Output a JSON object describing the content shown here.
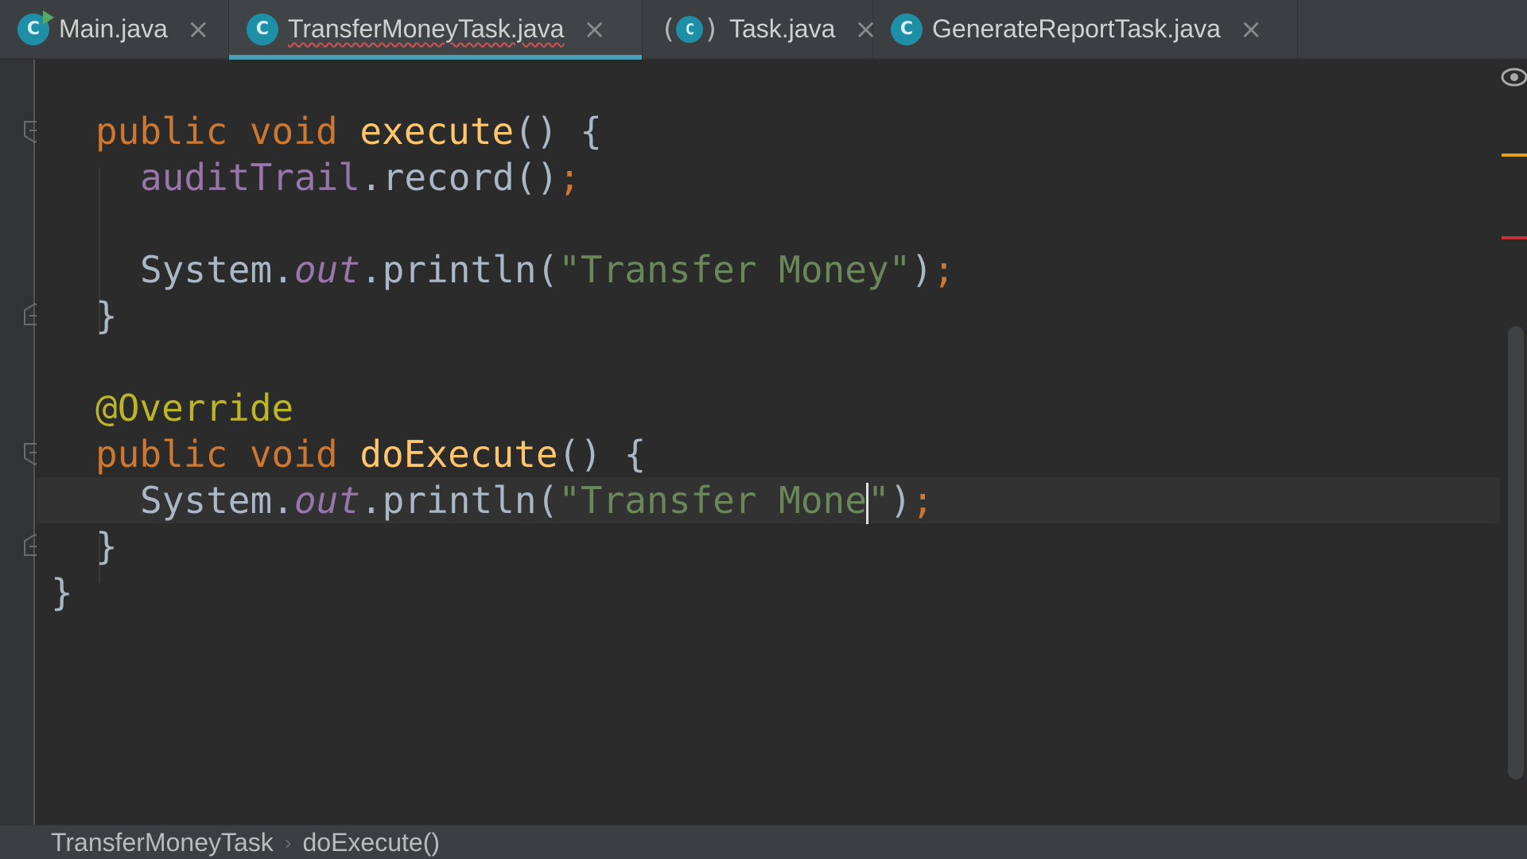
{
  "tabs": [
    {
      "label": "Main.java",
      "icon": "java-class-runnable-icon",
      "active": false
    },
    {
      "label": "TransferMoneyTask.java",
      "icon": "java-class-icon",
      "active": true,
      "error": true
    },
    {
      "label": "Task.java",
      "icon": "java-abstract-class-icon",
      "active": false
    },
    {
      "label": "GenerateReportTask.java",
      "icon": "java-class-icon",
      "active": false
    }
  ],
  "tab_icon_letter": "C",
  "close_glyph": "×",
  "code": {
    "l1_kw": "public void ",
    "l1_fn": "execute",
    "l1_rest": "() {",
    "l2_field": "auditTrail",
    "l2_rest": ".record()",
    "l2_semi": ";",
    "l4_sys": "System.",
    "l4_out": "out",
    "l4_print": ".println(",
    "l4_str": "\"Transfer Money\"",
    "l4_close": ")",
    "l4_semi": ";",
    "l5_brace": "}",
    "l7_ann": "@Override",
    "l8_kw": "public void ",
    "l8_fn": "doExecute",
    "l8_rest": "() {",
    "l9_sys": "System.",
    "l9_out": "out",
    "l9_print": ".println(",
    "l9_str_a": "\"Transfer Mone",
    "l9_str_b": "\"",
    "l9_close": ")",
    "l9_semi": ";",
    "l10_brace": "}",
    "l11_brace": "}"
  },
  "breadcrumb": {
    "class_name": "TransferMoneyTask",
    "separator": "›",
    "method": "doExecute()"
  },
  "colors": {
    "background": "#2b2b2b",
    "keyword": "#cc7832",
    "function": "#ffc66d",
    "field": "#9876aa",
    "string": "#6a8759",
    "annotation": "#bbb529",
    "tab_accent": "#4a9eb5",
    "warning_marker": "#e0a020",
    "error_marker": "#c8323c"
  }
}
